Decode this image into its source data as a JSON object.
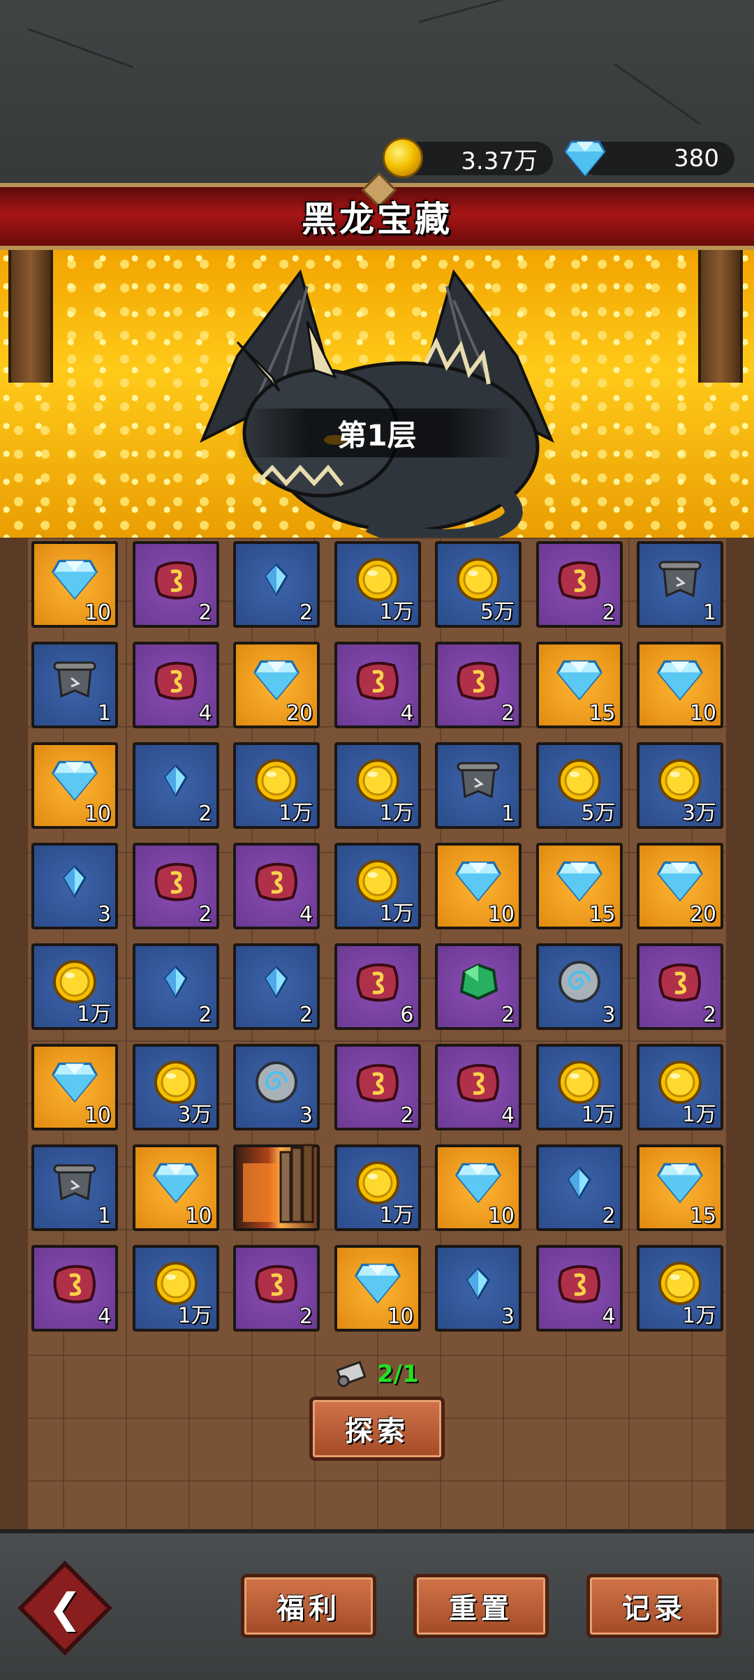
{
  "header": {
    "gold_amount": "3.37万",
    "gem_amount": "380",
    "title": "黑龙宝藏"
  },
  "floor": {
    "label": "第1层"
  },
  "board": {
    "rows": [
      [
        {
          "type": "diamond",
          "bg": "orange",
          "qty": "10"
        },
        {
          "type": "rune",
          "bg": "purple",
          "qty": "2"
        },
        {
          "type": "crystal",
          "bg": "blue",
          "qty": "2"
        },
        {
          "type": "coin",
          "bg": "blue",
          "qty": "1万"
        },
        {
          "type": "coin",
          "bg": "blue",
          "qty": "5万"
        },
        {
          "type": "rune",
          "bg": "purple",
          "qty": "2"
        },
        {
          "type": "scroll",
          "bg": "blue",
          "qty": "1"
        }
      ],
      [
        {
          "type": "scroll",
          "bg": "blue",
          "qty": "1"
        },
        {
          "type": "rune",
          "bg": "purple",
          "qty": "4"
        },
        {
          "type": "diamond",
          "bg": "orange",
          "qty": "20"
        },
        {
          "type": "rune",
          "bg": "purple",
          "qty": "4"
        },
        {
          "type": "rune",
          "bg": "purple",
          "qty": "2"
        },
        {
          "type": "diamond",
          "bg": "orange",
          "qty": "15"
        },
        {
          "type": "diamond",
          "bg": "orange",
          "qty": "10"
        }
      ],
      [
        {
          "type": "diamond",
          "bg": "orange",
          "qty": "10"
        },
        {
          "type": "crystal",
          "bg": "blue",
          "qty": "2"
        },
        {
          "type": "coin",
          "bg": "blue",
          "qty": "1万"
        },
        {
          "type": "coin",
          "bg": "blue",
          "qty": "1万"
        },
        {
          "type": "scroll",
          "bg": "blue",
          "qty": "1"
        },
        {
          "type": "coin",
          "bg": "blue",
          "qty": "5万"
        },
        {
          "type": "coin",
          "bg": "blue",
          "qty": "3万"
        }
      ],
      [
        {
          "type": "crystal",
          "bg": "blue",
          "qty": "3"
        },
        {
          "type": "rune",
          "bg": "purple",
          "qty": "2"
        },
        {
          "type": "rune",
          "bg": "purple",
          "qty": "4"
        },
        {
          "type": "coin",
          "bg": "blue",
          "qty": "1万"
        },
        {
          "type": "diamond",
          "bg": "orange",
          "qty": "10"
        },
        {
          "type": "diamond",
          "bg": "orange",
          "qty": "15"
        },
        {
          "type": "diamond",
          "bg": "orange",
          "qty": "20"
        }
      ],
      [
        {
          "type": "coin",
          "bg": "blue",
          "qty": "1万"
        },
        {
          "type": "crystal",
          "bg": "blue",
          "qty": "2"
        },
        {
          "type": "crystal",
          "bg": "blue",
          "qty": "2"
        },
        {
          "type": "rune",
          "bg": "purple",
          "qty": "6"
        },
        {
          "type": "emerald",
          "bg": "purple",
          "qty": "2"
        },
        {
          "type": "swirl",
          "bg": "blue",
          "qty": "3"
        },
        {
          "type": "rune",
          "bg": "purple",
          "qty": "2"
        }
      ],
      [
        {
          "type": "diamond",
          "bg": "orange",
          "qty": "10"
        },
        {
          "type": "coin",
          "bg": "blue",
          "qty": "3万"
        },
        {
          "type": "swirl",
          "bg": "blue",
          "qty": "3"
        },
        {
          "type": "rune",
          "bg": "purple",
          "qty": "2"
        },
        {
          "type": "rune",
          "bg": "purple",
          "qty": "4"
        },
        {
          "type": "coin",
          "bg": "blue",
          "qty": "1万"
        },
        {
          "type": "coin",
          "bg": "blue",
          "qty": "1万"
        }
      ],
      [
        {
          "type": "scroll",
          "bg": "blue",
          "qty": "1"
        },
        {
          "type": "diamond",
          "bg": "orange",
          "qty": "10"
        },
        {
          "type": "door",
          "bg": "door",
          "qty": ""
        },
        {
          "type": "coin",
          "bg": "blue",
          "qty": "1万"
        },
        {
          "type": "diamond",
          "bg": "orange",
          "qty": "10"
        },
        {
          "type": "crystal",
          "bg": "blue",
          "qty": "2"
        },
        {
          "type": "diamond",
          "bg": "orange",
          "qty": "15"
        }
      ],
      [
        {
          "type": "rune",
          "bg": "purple",
          "qty": "4"
        },
        {
          "type": "coin",
          "bg": "blue",
          "qty": "1万"
        },
        {
          "type": "rune",
          "bg": "purple",
          "qty": "2"
        },
        {
          "type": "diamond",
          "bg": "orange",
          "qty": "10"
        },
        {
          "type": "crystal",
          "bg": "blue",
          "qty": "3"
        },
        {
          "type": "rune",
          "bg": "purple",
          "qty": "4"
        },
        {
          "type": "coin",
          "bg": "blue",
          "qty": "1万"
        }
      ]
    ]
  },
  "explore": {
    "count": "2/1",
    "button_label": "探索"
  },
  "footer": {
    "welfare_label": "福利",
    "reset_label": "重置",
    "record_label": "记录",
    "back_icon": "back-arrow-icon"
  },
  "colors": {
    "cell_blue": "#2b4c8c",
    "cell_purple": "#6b3a94",
    "cell_orange": "#e08a10",
    "banner_red": "#a71616",
    "count_green": "#22e022"
  }
}
